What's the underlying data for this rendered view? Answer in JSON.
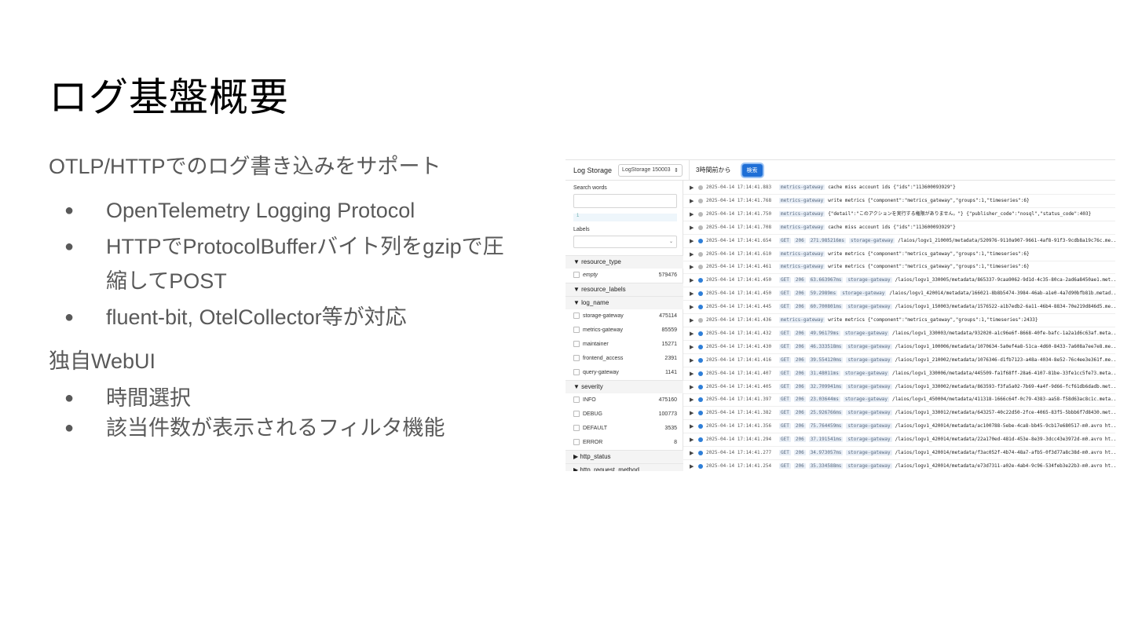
{
  "slide": {
    "title": "ログ基盤概要",
    "section1": "OTLP/HTTPでのログ書き込みをサポート",
    "bullets1": [
      "OpenTelemetry Logging Protocol",
      "HTTPでProtocolBufferバイト列をgzipで圧縮してPOST",
      "fluent-bit, OtelCollector等が対応"
    ],
    "section2": "独自WebUI",
    "bullets2": [
      "時間選択",
      "該当件数が表示されるフィルタ機能"
    ]
  },
  "screenshot": {
    "app_title": "Log Storage",
    "storage_select": "LogStorage 150003",
    "time_range": "3時間前から",
    "search_button": "検索",
    "search_words_label": "Search words",
    "chip_text": "1",
    "labels_label": "Labels",
    "facets": [
      {
        "name": "resource_type",
        "arrow": "▼",
        "items": [
          {
            "name": "empty",
            "count": "579476"
          }
        ]
      },
      {
        "name": "resource_labels",
        "arrow": "▼",
        "items": []
      },
      {
        "name": "log_name",
        "arrow": "▼",
        "items": [
          {
            "name": "storage-gateway",
            "count": "475114"
          },
          {
            "name": "metrics-gateway",
            "count": "85559"
          },
          {
            "name": "maintainer",
            "count": "15271"
          },
          {
            "name": "frontend_access",
            "count": "2391"
          },
          {
            "name": "query-gateway",
            "count": "1141"
          }
        ]
      },
      {
        "name": "severity",
        "arrow": "▼",
        "items": [
          {
            "name": "INFO",
            "count": "475160"
          },
          {
            "name": "DEBUG",
            "count": "100773"
          },
          {
            "name": "DEFAULT",
            "count": "3535"
          },
          {
            "name": "ERROR",
            "count": "8"
          }
        ]
      },
      {
        "name": "http_status",
        "arrow": "▶",
        "items": []
      },
      {
        "name": "http_request_method",
        "arrow": "▶",
        "items": []
      }
    ],
    "logs": [
      {
        "ts": "2025-04-14 17:14:41.883",
        "level": "debug",
        "tags": [
          "metrics-gateway"
        ],
        "msg": "cache miss account ids {\"ids\":\"113600093929\"}"
      },
      {
        "ts": "2025-04-14 17:14:41.768",
        "level": "debug",
        "tags": [
          "metrics-gateway"
        ],
        "msg": "write metrics {\"component\":\"metrics_gateway\",\"groups\":1,\"timeseries\":6}"
      },
      {
        "ts": "2025-04-14 17:14:41.750",
        "level": "debug",
        "tags": [
          "metrics-gateway"
        ],
        "msg": "{\"detail\":\"このアクションを実行する権限がありません。\"} {\"publisher_code\":\"nosql\",\"status_code\":403}"
      },
      {
        "ts": "2025-04-14 17:14:41.708",
        "level": "debug",
        "tags": [
          "metrics-gateway"
        ],
        "msg": "cache miss account ids {\"ids\":\"113600093929\"}"
      },
      {
        "ts": "2025-04-14 17:14:41.654",
        "level": "info",
        "tags": [
          "GET",
          "206",
          "271.985216ms",
          "storage-gateway"
        ],
        "msg": "/laios/logv1_210005/metadata/520976-9110a907-9661-4af8-91f3-9cdb8a19c76c.me..."
      },
      {
        "ts": "2025-04-14 17:14:41.610",
        "level": "debug",
        "tags": [
          "metrics-gateway"
        ],
        "msg": "write metrics {\"component\":\"metrics_gateway\",\"groups\":1,\"timeseries\":6}"
      },
      {
        "ts": "2025-04-14 17:14:41.461",
        "level": "debug",
        "tags": [
          "metrics-gateway"
        ],
        "msg": "write metrics {\"component\":\"metrics_gateway\",\"groups\":1,\"timeseries\":6}"
      },
      {
        "ts": "2025-04-14 17:14:41.450",
        "level": "info",
        "tags": [
          "GET",
          "206",
          "63.663967ms",
          "storage-gateway"
        ],
        "msg": "/laios/logv1_330005/metadata/865337-9caa9062-9d1d-4c35-80ca-2ad6a8450ae1.met..."
      },
      {
        "ts": "2025-04-14 17:14:41.450",
        "level": "info",
        "tags": [
          "GET",
          "206",
          "59.2989ms",
          "storage-gateway"
        ],
        "msg": "/laios/logv1_420014/metadata/166021-8b8b5474-3984-46ab-a1e0-4a7d90bfb81b.metad..."
      },
      {
        "ts": "2025-04-14 17:14:41.445",
        "level": "info",
        "tags": [
          "GET",
          "206",
          "60.700801ms",
          "storage-gateway"
        ],
        "msg": "/laios/logv1_150003/metadata/1576522-a1b7edb2-6a11-46b4-8834-70e219d846d5.me..."
      },
      {
        "ts": "2025-04-14 17:14:41.436",
        "level": "debug",
        "tags": [
          "metrics-gateway"
        ],
        "msg": "write metrics {\"component\":\"metrics_gateway\",\"groups\":1,\"timeseries\":2433}"
      },
      {
        "ts": "2025-04-14 17:14:41.432",
        "level": "info",
        "tags": [
          "GET",
          "206",
          "49.96179ms",
          "storage-gateway"
        ],
        "msg": "/laios/logv1_330003/metadata/932020-a1c96e6f-8668-40fe-bafc-1a2a1d6c63af.meta..."
      },
      {
        "ts": "2025-04-14 17:14:41.430",
        "level": "info",
        "tags": [
          "GET",
          "206",
          "46.333518ms",
          "storage-gateway"
        ],
        "msg": "/laios/logv1_100006/metadata/1070634-5a0ef4a8-51ca-4d60-8433-7a608a7ee7e8.me..."
      },
      {
        "ts": "2025-04-14 17:14:41.416",
        "level": "info",
        "tags": [
          "GET",
          "206",
          "39.554120ms",
          "storage-gateway"
        ],
        "msg": "/laios/logv1_210002/metadata/1076346-d1fb7123-a48a-4034-8e52-76c4ee3e361f.me..."
      },
      {
        "ts": "2025-04-14 17:14:41.407",
        "level": "info",
        "tags": [
          "GET",
          "206",
          "31.48011ms",
          "storage-gateway"
        ],
        "msg": "/laios/logv1_330006/metadata/445509-fa1f68ff-28a6-4107-81be-33fe1cc5fe73.meta..."
      },
      {
        "ts": "2025-04-14 17:14:41.405",
        "level": "info",
        "tags": [
          "GET",
          "206",
          "32.709941ms",
          "storage-gateway"
        ],
        "msg": "/laios/logv1_330002/metadata/863593-f3fa5a02-7b69-4a4f-9d66-fcf61db6dadb.met..."
      },
      {
        "ts": "2025-04-14 17:14:41.397",
        "level": "info",
        "tags": [
          "GET",
          "206",
          "23.03644ms",
          "storage-gateway"
        ],
        "msg": "/laios/logv1_450004/metadata/411318-1666c64f-0c79-4383-aa58-f58d63ac8c1c.meta..."
      },
      {
        "ts": "2025-04-14 17:14:41.382",
        "level": "info",
        "tags": [
          "GET",
          "206",
          "25.926766ms",
          "storage-gateway"
        ],
        "msg": "/laios/logv1_330012/metadata/643257-40c22d50-2fce-4065-83f5-5bbb6f7d8430.met..."
      },
      {
        "ts": "2025-04-14 17:14:41.356",
        "level": "info",
        "tags": [
          "GET",
          "206",
          "75.764459ms",
          "storage-gateway"
        ],
        "msg": "/laios/logv1_420014/metadata/ac100788-5ebe-4ca8-bb45-9cb17e680517-m0.avro ht..."
      },
      {
        "ts": "2025-04-14 17:14:41.294",
        "level": "info",
        "tags": [
          "GET",
          "206",
          "37.191541ms",
          "storage-gateway"
        ],
        "msg": "/laios/logv1_420014/metadata/22a170ed-481d-453e-8e39-3dcc43e3972d-m0.avro ht..."
      },
      {
        "ts": "2025-04-14 17:14:41.277",
        "level": "info",
        "tags": [
          "GET",
          "206",
          "34.973057ms",
          "storage-gateway"
        ],
        "msg": "/laios/logv1_420014/metadata/f3ac052f-4b74-48a7-afb5-0f3d77a8c38d-m0.avro ht..."
      },
      {
        "ts": "2025-04-14 17:14:41.254",
        "level": "info",
        "tags": [
          "GET",
          "206",
          "35.334588ms",
          "storage-gateway"
        ],
        "msg": "/laios/logv1_420014/metadata/e73d7311-a02e-4ab4-9c96-534feb3e22b3-m0.avro ht..."
      }
    ],
    "colors": {
      "debug_dot": "#b9b9b9",
      "info_dot": "#2f7fd8",
      "accent": "#1f6fd6"
    }
  }
}
